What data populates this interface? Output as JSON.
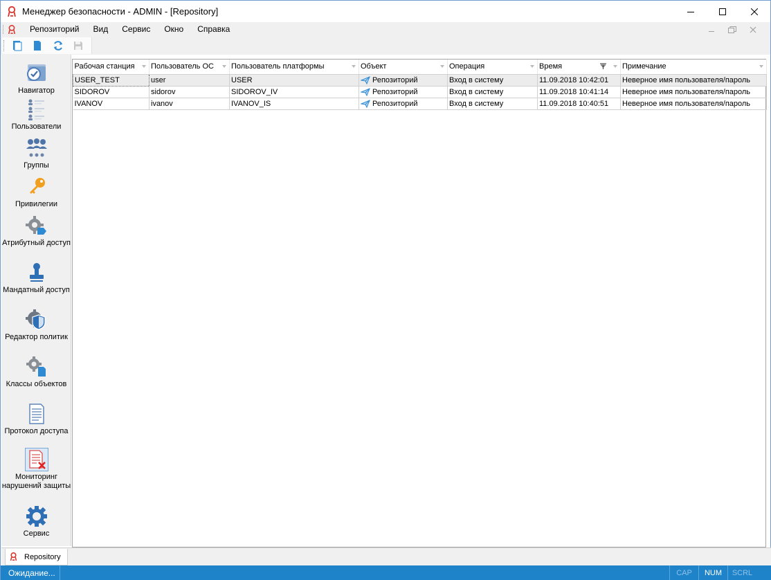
{
  "window": {
    "title": "Менеджер безопасности - ADMIN - [Repository]"
  },
  "menu": {
    "items": [
      "Репозиторий",
      "Вид",
      "Сервис",
      "Окно",
      "Справка"
    ]
  },
  "toolbar": {
    "buttons": [
      "new-document-icon",
      "open-document-icon",
      "refresh-icon",
      "save-icon"
    ]
  },
  "nav": {
    "items": [
      {
        "label": "Навигатор",
        "icon": "navigator-icon"
      },
      {
        "label": "Пользователи",
        "icon": "users-list-icon"
      },
      {
        "label": "Группы",
        "icon": "groups-icon"
      },
      {
        "label": "Привилегии",
        "icon": "key-icon"
      },
      {
        "label": "Атрибутный доступ",
        "icon": "attribute-access-icon"
      },
      {
        "label": "Мандатный доступ",
        "icon": "mandatory-access-icon"
      },
      {
        "label": "Редактор политик",
        "icon": "policy-editor-icon"
      },
      {
        "label": "Классы объектов",
        "icon": "object-classes-icon"
      },
      {
        "label": "Протокол доступа",
        "icon": "access-log-icon"
      },
      {
        "label": "Мониторинг нарушений защиты",
        "icon": "security-violations-icon"
      },
      {
        "label": "Сервис",
        "icon": "service-gear-icon"
      }
    ],
    "selected": "Мониторинг нарушений защиты"
  },
  "grid": {
    "columns": [
      "Рабочая станция",
      "Пользователь ОС",
      "Пользователь платформы",
      "Объект",
      "Операция",
      "Время",
      "Примечание"
    ],
    "rows": [
      {
        "workstation": "USER_TEST",
        "os_user": "user",
        "platform_user": "USER",
        "object": "Репозиторий",
        "operation": "Вход в систему",
        "time": "11.09.2018 10:42:01",
        "note": "Неверное имя пользователя/пароль"
      },
      {
        "workstation": "SIDOROV",
        "os_user": "sidorov",
        "platform_user": "SIDOROV_IV",
        "object": "Репозиторий",
        "operation": "Вход в систему",
        "time": "11.09.2018 10:41:14",
        "note": "Неверное имя пользователя/пароль"
      },
      {
        "workstation": "IVANOV",
        "os_user": "ivanov",
        "platform_user": "IVANOV_IS",
        "object": "Репозиторий",
        "operation": "Вход в систему",
        "time": "11.09.2018 10:40:51",
        "note": "Неверное имя пользователя/пароль"
      }
    ]
  },
  "doctab": {
    "label": "Repository"
  },
  "status": {
    "text": "Ожидание...",
    "cap": "CAP",
    "num": "NUM",
    "scrl": "SCRL"
  },
  "colors": {
    "accent": "#1e83c9",
    "selection_bg": "#dbe9f7"
  }
}
